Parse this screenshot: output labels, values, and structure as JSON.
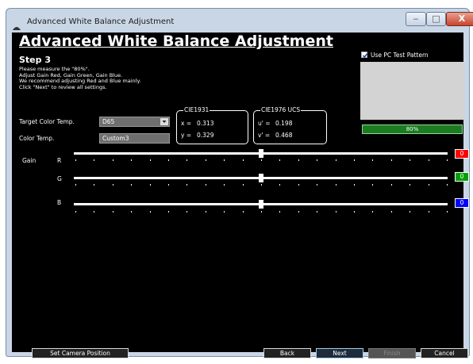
{
  "window": {
    "title": "Advanced White Balance Adjustment"
  },
  "window_controls": {
    "minimize": "‒",
    "maximize": "□",
    "close": "X"
  },
  "page": {
    "title": "Advanced White Balance Adjustment",
    "step": "Step 3",
    "instructions": [
      "Please measure the \"80%\".",
      "Adjust Gain Red, Gain Green, Gain Blue.",
      "We recommend adjusting Red and Blue mainly.",
      "Click \"Next\" to review all settings."
    ]
  },
  "target_color_temp": {
    "label": "Target Color Temp.",
    "value": "D65"
  },
  "color_temp": {
    "label": "Color Temp.",
    "value": "Custom3"
  },
  "cie1931": {
    "title": "CIE1931",
    "x_label": "x =",
    "x_value": "0.313",
    "y_label": "y =",
    "y_value": "0.329"
  },
  "cie1976": {
    "title": "CIE1976 UCS",
    "u_label": "u' =",
    "u_value": "0.198",
    "v_label": "v' =",
    "v_value": "0.468"
  },
  "test_pattern": {
    "checkbox_label": "Use PC Test Pattern",
    "checked": true,
    "level_label": "80%"
  },
  "gain": {
    "label": "Gain",
    "channels": [
      {
        "name": "R",
        "color": "#ff0000",
        "value": "0",
        "position": 0.5
      },
      {
        "name": "G",
        "color": "#00a000",
        "value": "0",
        "position": 0.5
      },
      {
        "name": "B",
        "color": "#0000ff",
        "value": "0",
        "position": 0.5
      }
    ]
  },
  "buttons": {
    "set_camera_position": "Set Camera Position",
    "back": "Back",
    "next": "Next",
    "finish": "Finish",
    "cancel": "Cancel"
  }
}
